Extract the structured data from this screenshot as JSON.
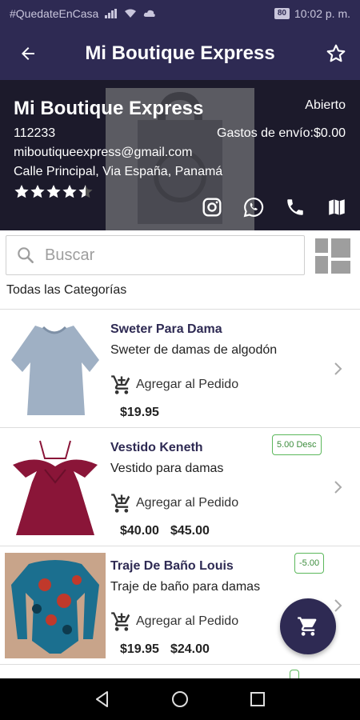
{
  "status_bar": {
    "hashtag": "#QuedateEnCasa",
    "battery": "80",
    "time": "10:02 p. m."
  },
  "app_bar": {
    "title": "Mi Boutique Express"
  },
  "store": {
    "name": "Mi Boutique Express",
    "open_status": "Abierto",
    "code": "112233",
    "shipping": "Gastos de envío:$0.00",
    "email": "miboutiqueexpress@gmail.com",
    "address": "Calle Principal, Via España, Panamá",
    "rating": 4.5,
    "rating_stars": "★★★★★"
  },
  "search": {
    "placeholder": "Buscar"
  },
  "categories": {
    "label": "Todas las Categorías"
  },
  "products": [
    {
      "name": "Sweter Para Dama",
      "description": "Sweter de damas de algodón",
      "add_label": "Agregar al Pedido",
      "price": "$19.95",
      "old_price": "",
      "badge": ""
    },
    {
      "name": "Vestido Keneth",
      "description": "Vestido para damas",
      "add_label": "Agregar al Pedido",
      "price": "$40.00",
      "old_price": "$45.00",
      "badge": "5.00 Desc"
    },
    {
      "name": "Traje De Baño Louis",
      "description": "Traje de baño para damas",
      "add_label": "Agregar al Pedido",
      "price": "$19.95",
      "old_price": "$24.00",
      "badge": "-5.00"
    }
  ],
  "colors": {
    "primary": "#2e2a53",
    "header_bg": "#1c1a2b",
    "badge_green": "#5cb85c"
  },
  "icons": [
    "back-arrow-icon",
    "star-outline-icon",
    "instagram-icon",
    "whatsapp-icon",
    "phone-icon",
    "map-icon",
    "search-icon",
    "grid-view-icon",
    "add-to-cart-icon",
    "chevron-right-icon",
    "cart-icon"
  ]
}
